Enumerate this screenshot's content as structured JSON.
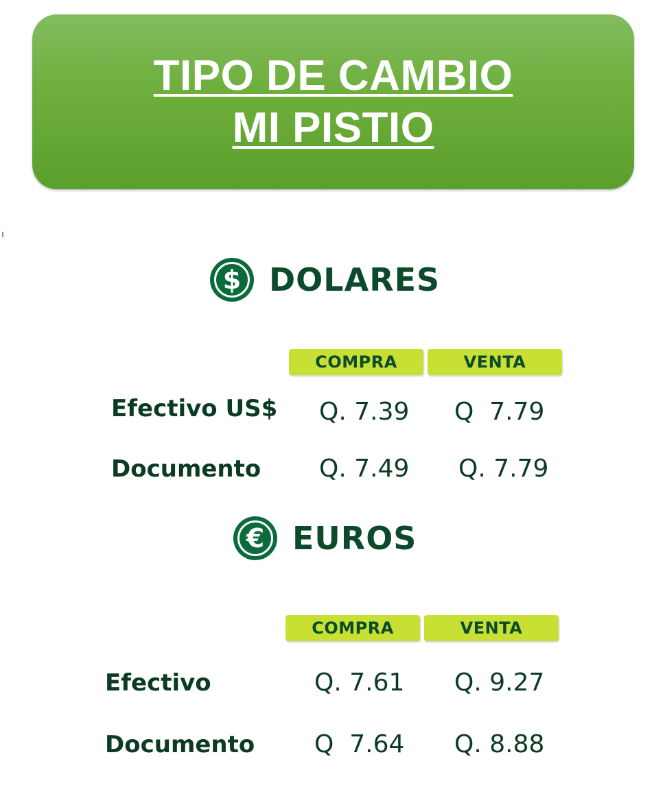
{
  "banner": {
    "title_line1": "TIPO DE CAMBIO",
    "title_line2": "MI PISTIO",
    "color": "#6eae3c"
  },
  "dolares": {
    "icon": "dollar-coin-icon",
    "icon_glyph": "$",
    "title": "DOLARES",
    "headers": {
      "compra": "COMPRA",
      "venta": "VENTA"
    },
    "rows": [
      {
        "label": "Efectivo US$",
        "compra": "Q. 7.39",
        "venta": "Q  7.79"
      },
      {
        "label": "Documento",
        "compra": "Q. 7.49",
        "venta": "Q. 7.79"
      }
    ]
  },
  "euros": {
    "icon": "euro-coin-icon",
    "icon_glyph": "€",
    "title": "EUROS",
    "headers": {
      "compra": "COMPRA",
      "venta": "VENTA"
    },
    "rows": [
      {
        "label": "Efectivo",
        "compra": "Q. 7.61",
        "venta": "Q. 9.27"
      },
      {
        "label": "Documento",
        "compra": "Q  7.64",
        "venta": "Q. 8.88"
      }
    ]
  },
  "colors": {
    "dark_green": "#0c4a2c",
    "coin_green": "#0c6b3c",
    "header_lime": "#c7e033"
  }
}
